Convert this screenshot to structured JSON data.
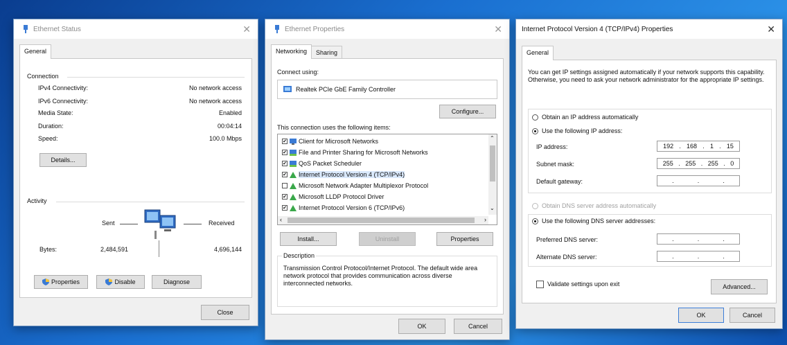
{
  "status_window": {
    "title": "Ethernet Status",
    "tab": "General",
    "connection_label": "Connection",
    "rows": [
      {
        "label": "IPv4 Connectivity:",
        "value": "No network access"
      },
      {
        "label": "IPv6 Connectivity:",
        "value": "No network access"
      },
      {
        "label": "Media State:",
        "value": "Enabled"
      },
      {
        "label": "Duration:",
        "value": "00:04:14"
      },
      {
        "label": "Speed:",
        "value": "100.0 Mbps"
      }
    ],
    "details_btn": "Details...",
    "activity_label": "Activity",
    "sent_label": "Sent",
    "received_label": "Received",
    "bytes_label": "Bytes:",
    "bytes_sent": "2,484,591",
    "bytes_received": "4,696,144",
    "properties_btn": "Properties",
    "disable_btn": "Disable",
    "diagnose_btn": "Diagnose",
    "close_btn": "Close"
  },
  "properties_window": {
    "title": "Ethernet Properties",
    "tabs": [
      "Networking",
      "Sharing"
    ],
    "connect_using_label": "Connect using:",
    "adapter": "Realtek PCIe GbE Family Controller",
    "configure_btn": "Configure...",
    "items_label": "This connection uses the following items:",
    "items": [
      {
        "text": "Client for Microsoft Networks",
        "checked": true,
        "icon": "network-client-icon"
      },
      {
        "text": "File and Printer Sharing for Microsoft Networks",
        "checked": true,
        "icon": "network-service-icon"
      },
      {
        "text": "QoS Packet Scheduler",
        "checked": true,
        "icon": "network-service-icon"
      },
      {
        "text": "Internet Protocol Version 4 (TCP/IPv4)",
        "checked": true,
        "icon": "protocol-icon"
      },
      {
        "text": "Microsoft Network Adapter Multiplexor Protocol",
        "checked": false,
        "icon": "protocol-icon"
      },
      {
        "text": "Microsoft LLDP Protocol Driver",
        "checked": true,
        "icon": "protocol-icon"
      },
      {
        "text": "Internet Protocol Version 6 (TCP/IPv6)",
        "checked": true,
        "icon": "protocol-icon"
      }
    ],
    "install_btn": "Install...",
    "uninstall_btn": "Uninstall",
    "properties_btn": "Properties",
    "description_label": "Description",
    "description": "Transmission Control Protocol/Internet Protocol. The default wide area network protocol that provides communication across diverse interconnected networks.",
    "ok_btn": "OK",
    "cancel_btn": "Cancel"
  },
  "ipv4_window": {
    "title": "Internet Protocol Version 4 (TCP/IPv4) Properties",
    "tab": "General",
    "intro": "You can get IP settings assigned automatically if your network supports this capability. Otherwise, you need to ask your network administrator for the appropriate IP settings.",
    "auto_ip_label": "Obtain an IP address automatically",
    "manual_ip_label": "Use the following IP address:",
    "ip_address_label": "IP address:",
    "ip_address": [
      "192",
      "168",
      "1",
      "15"
    ],
    "subnet_label": "Subnet mask:",
    "subnet": [
      "255",
      "255",
      "255",
      "0"
    ],
    "gateway_label": "Default gateway:",
    "auto_dns_label": "Obtain DNS server address automatically",
    "manual_dns_label": "Use the following DNS server addresses:",
    "preferred_dns_label": "Preferred DNS server:",
    "alternate_dns_label": "Alternate DNS server:",
    "validate_label": "Validate settings upon exit",
    "advanced_btn": "Advanced...",
    "ok_btn": "OK",
    "cancel_btn": "Cancel"
  }
}
